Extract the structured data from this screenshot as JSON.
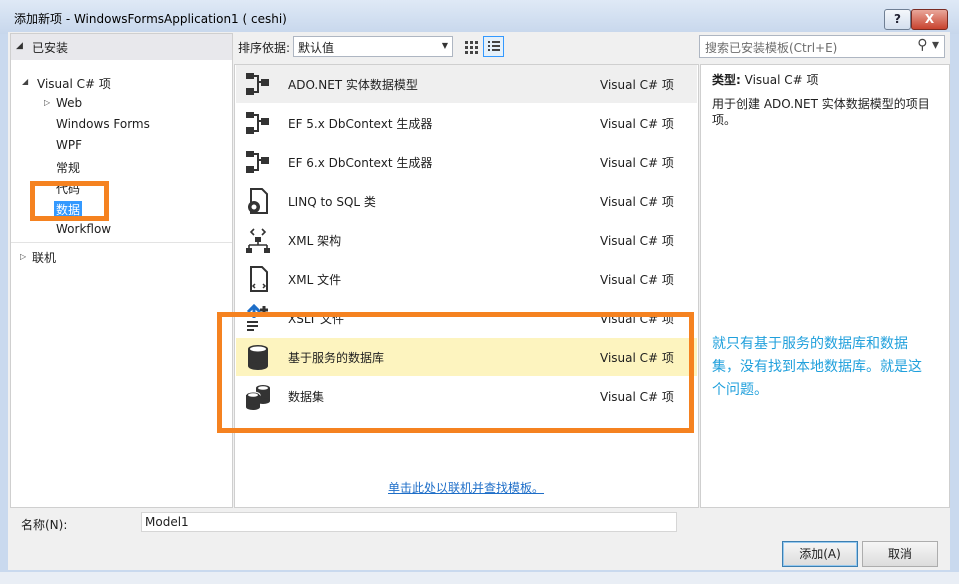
{
  "window": {
    "title": "添加新项 - WindowsFormsApplication1 ( ceshi)",
    "help_label": "?",
    "close_label": "X"
  },
  "left": {
    "installed_label": "已安装",
    "tree": [
      {
        "label": "Visual C# 项"
      },
      {
        "label": "Web"
      },
      {
        "label": "Windows Forms"
      },
      {
        "label": "WPF"
      },
      {
        "label": "常规"
      },
      {
        "label": "代码"
      },
      {
        "label": "数据"
      },
      {
        "label": "Workflow"
      }
    ],
    "online_label": "联机"
  },
  "toolbar": {
    "sort_label": "排序依据:",
    "sort_value": "默认值",
    "search_placeholder": "搜索已安装模板(Ctrl+E)"
  },
  "templates": [
    {
      "name": "ADO.NET 实体数据模型",
      "type": "Visual C# 项",
      "icon": "ado-entity-icon"
    },
    {
      "name": "EF 5.x DbContext 生成器",
      "type": "Visual C# 项",
      "icon": "ef-generator-icon"
    },
    {
      "name": "EF 6.x DbContext 生成器",
      "type": "Visual C# 项",
      "icon": "ef-generator-icon"
    },
    {
      "name": "LINQ to SQL 类",
      "type": "Visual C# 项",
      "icon": "linq-icon"
    },
    {
      "name": "XML 架构",
      "type": "Visual C# 项",
      "icon": "xml-schema-icon"
    },
    {
      "name": "XML 文件",
      "type": "Visual C# 项",
      "icon": "xml-file-icon"
    },
    {
      "name": "XSLT 文件",
      "type": "Visual C# 项",
      "icon": "xslt-icon"
    },
    {
      "name": "基于服务的数据库",
      "type": "Visual C# 项",
      "icon": "database-icon"
    },
    {
      "name": "数据集",
      "type": "Visual C# 项",
      "icon": "dataset-icon"
    }
  ],
  "online_link": "单击此处以联机并查找模板。",
  "detail": {
    "type_label": "类型:",
    "type_value": "Visual C# 项",
    "description": "用于创建 ADO.NET 实体数据模型的项目项。"
  },
  "annotation": "就只有基于服务的数据库和数据集，没有找到本地数据库。就是这个问题。",
  "bottom": {
    "name_label": "名称(N):",
    "name_value": "Model1",
    "add_label": "添加(A)",
    "cancel_label": "取消"
  },
  "colors": {
    "highlight_box": "#f58220",
    "annotation_text": "#20a0dc",
    "selected_tree": "#3399ff"
  }
}
